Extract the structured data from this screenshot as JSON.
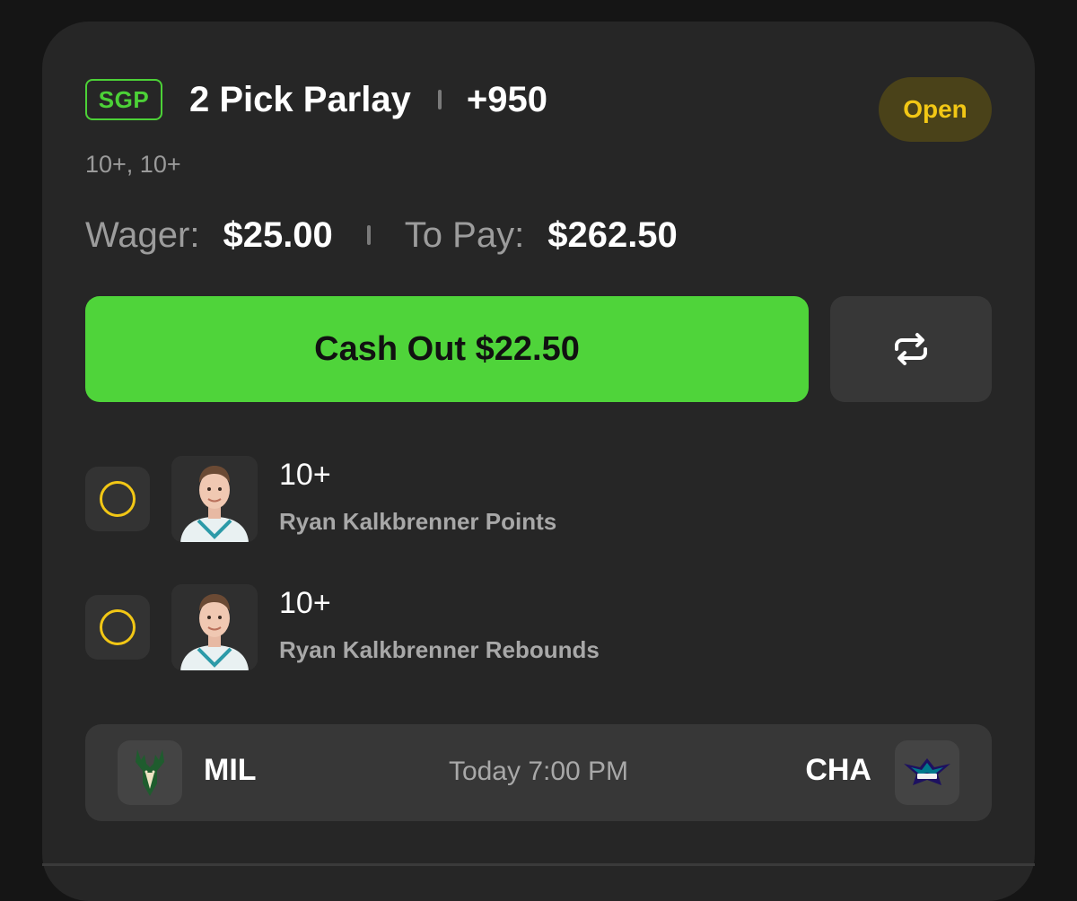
{
  "bet": {
    "badge": "SGP",
    "title": "2 Pick Parlay",
    "odds": "+950",
    "subtitle": "10+, 10+",
    "status": "Open"
  },
  "wager": {
    "wager_label": "Wager:",
    "wager_value": "$25.00",
    "to_pay_label": "To Pay:",
    "to_pay_value": "$262.50"
  },
  "actions": {
    "cash_out_label": "Cash Out $22.50",
    "swap_icon": "repeat-icon"
  },
  "legs": [
    {
      "line": "10+",
      "market": "Ryan Kalkbrenner Points",
      "status_icon": "pending-circle-icon"
    },
    {
      "line": "10+",
      "market": "Ryan Kalkbrenner Rebounds",
      "status_icon": "pending-circle-icon"
    }
  ],
  "game": {
    "away_abbr": "MIL",
    "home_abbr": "CHA",
    "time": "Today 7:00 PM",
    "away_logo": "bucks-logo-icon",
    "home_logo": "hornets-logo-icon"
  },
  "colors": {
    "accent_green": "#4fd43a",
    "pending_yellow": "#f2c715",
    "card_bg": "#262626"
  }
}
